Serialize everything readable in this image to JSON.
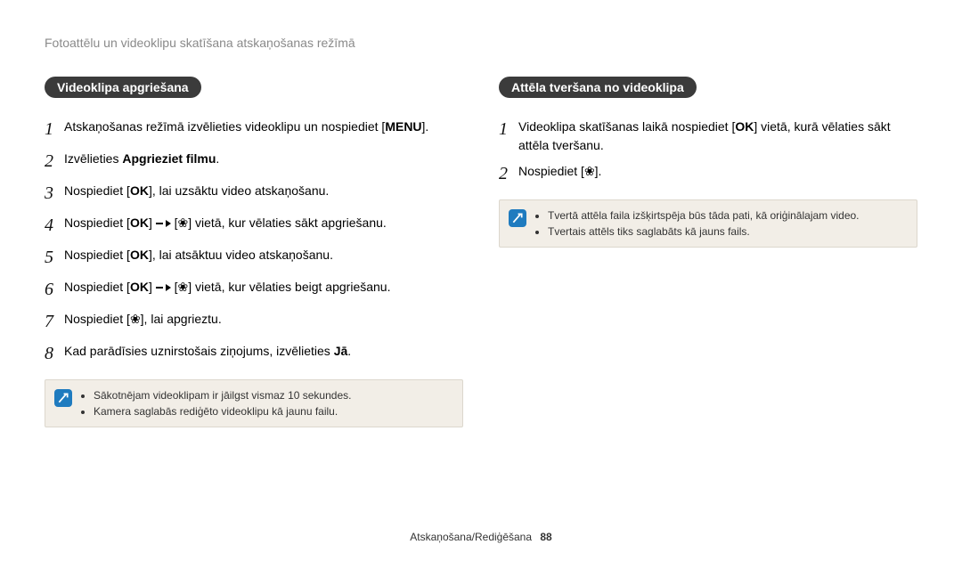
{
  "header": "Fotoattēlu un videoklipu skatīšana atskaņošanas režīmā",
  "left": {
    "pill": "Videoklipa apgriešana",
    "steps": {
      "s1": {
        "num": "1",
        "p1": "Atskaņošanas režīmā izvēlieties videoklipu un nospiediet [",
        "btn": "MENU",
        "p2": "]."
      },
      "s2": {
        "num": "2",
        "p1": "Izvēlieties ",
        "bold": "Apgrieziet filmu",
        "p2": "."
      },
      "s3": {
        "num": "3",
        "p1": "Nospiediet [",
        "btn": "OK",
        "p2": "], lai uzsāktu video atskaņošanu."
      },
      "s4": {
        "num": "4",
        "p1": "Nospiediet [",
        "btn": "OK",
        "p2": "] ",
        "p3": " [",
        "icon": "❀",
        "p4": "] vietā, kur vēlaties sākt apgriešanu."
      },
      "s5": {
        "num": "5",
        "p1": "Nospiediet [",
        "btn": "OK",
        "p2": "], lai atsāktuu video atskaņošanu."
      },
      "s6": {
        "num": "6",
        "p1": "Nospiediet [",
        "btn": "OK",
        "p2": "] ",
        "p3": " [",
        "icon": "❀",
        "p4": "] vietā, kur vēlaties beigt apgriešanu."
      },
      "s7": {
        "num": "7",
        "p1": "Nospiediet [",
        "icon": "❀",
        "p2": "], lai apgrieztu."
      },
      "s8": {
        "num": "8",
        "p1": "Kad parādīsies uznirstošais ziņojums, izvēlieties ",
        "bold": "Jā",
        "p2": "."
      }
    },
    "note1": "Sākotnējam videoklipam ir jāilgst vismaz 10 sekundes.",
    "note2": "Kamera saglabās rediģēto videoklipu kā jaunu failu."
  },
  "right": {
    "pill": "Attēla tveršana no videoklipa",
    "steps": {
      "s1": {
        "num": "1",
        "p1": "Videoklipa skatīšanas laikā nospiediet [",
        "btn": "OK",
        "p2": "] vietā, kurā vēlaties sākt attēla tveršanu."
      },
      "s2": {
        "num": "2",
        "p1": "Nospiediet [",
        "icon": "❀",
        "p2": "]."
      }
    },
    "note1": "Tvertā attēla faila izšķirtspēja būs tāda pati, kā oriģinālajam video.",
    "note2": "Tvertais attēls tiks saglabāts kā jauns fails."
  },
  "footer": {
    "section": "Atskaņošana/Rediģēšana",
    "page": "88"
  }
}
